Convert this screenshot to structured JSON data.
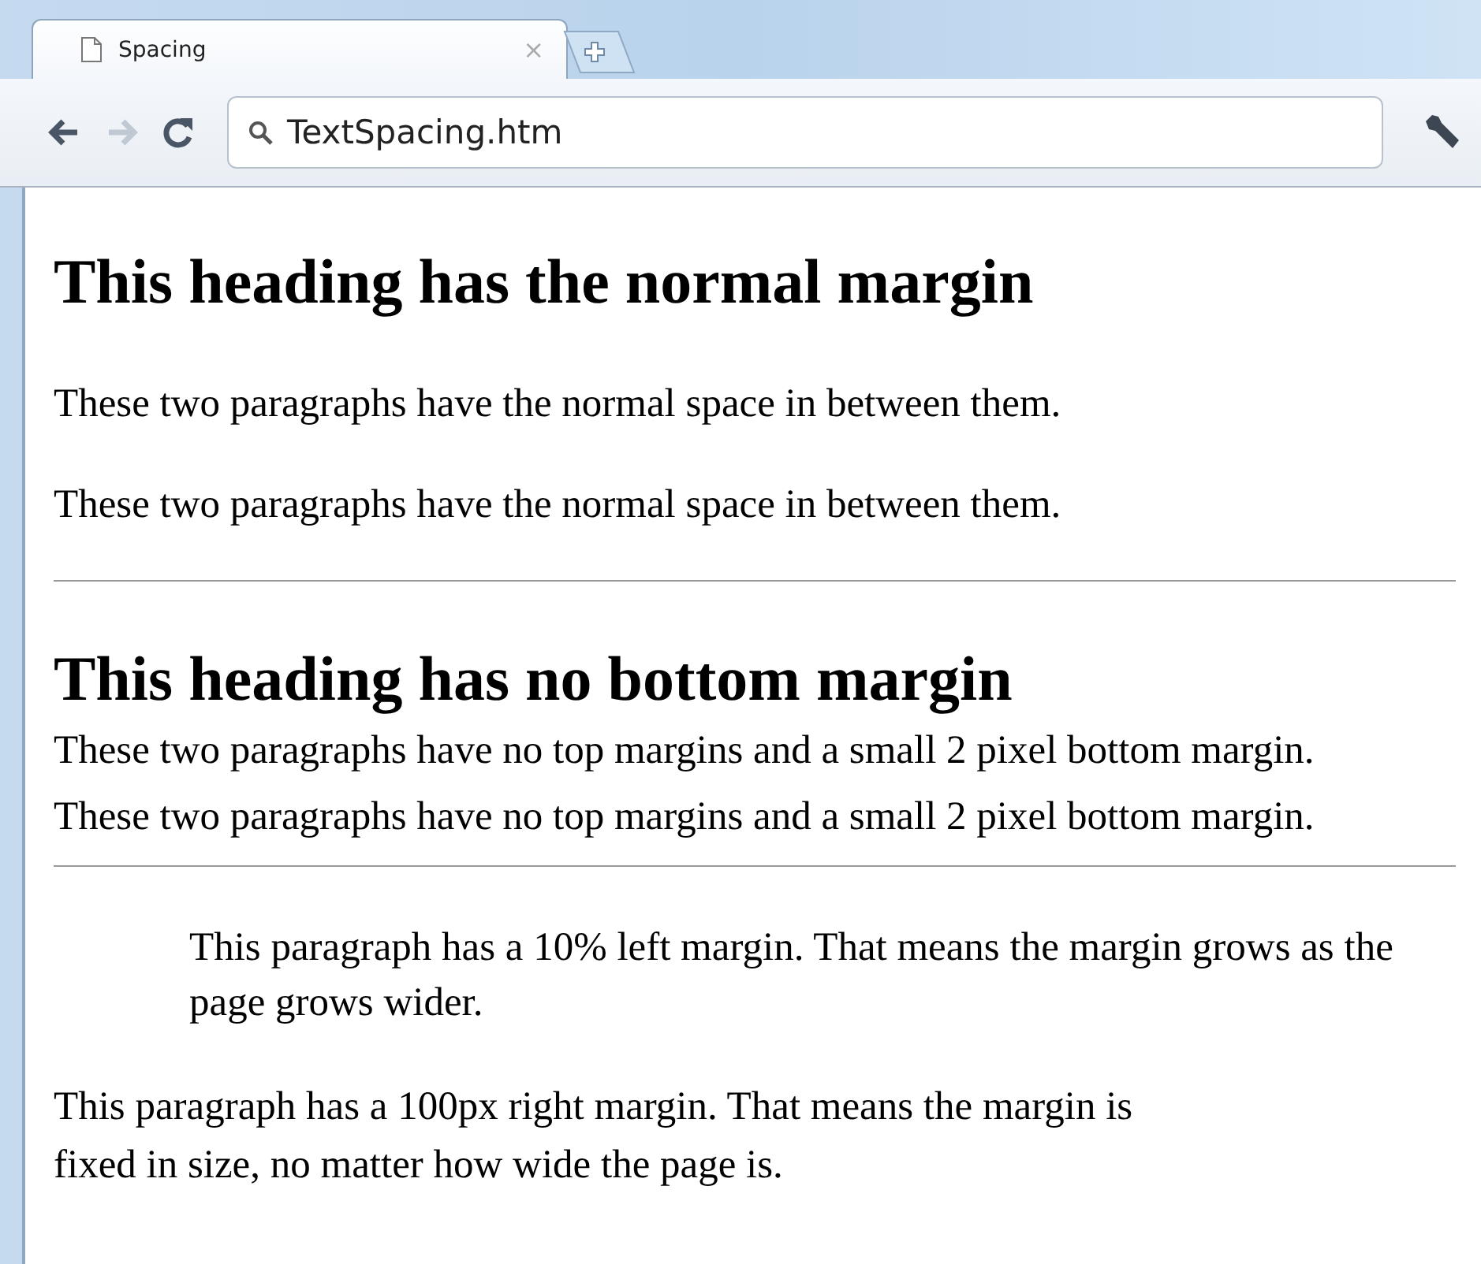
{
  "tabs": [
    {
      "title": "Spacing",
      "close": "×",
      "selected": true
    }
  ],
  "nav_buttons": [
    {
      "kind": "back",
      "disabled": false
    },
    {
      "kind": "forward",
      "disabled": true
    },
    {
      "kind": "reload",
      "disabled": false
    }
  ],
  "address_bar": {
    "value": "TextSpacing.htm"
  },
  "content": [
    {
      "kind": "heading",
      "text": "This heading has the normal margin"
    },
    {
      "kind": "paragraph",
      "text": "These two paragraphs have the normal space in between them."
    },
    {
      "kind": "paragraph",
      "text": "These two paragraphs have the normal space in between them."
    },
    {
      "kind": "rule"
    },
    {
      "kind": "heading",
      "text": "This heading has no bottom margin"
    },
    {
      "kind": "paragraph",
      "text": "These two paragraphs have no top margins and a small 2 pixel bottom margin."
    },
    {
      "kind": "paragraph",
      "text": "These two paragraphs have no top margins and a small 2 pixel bottom margin."
    },
    {
      "kind": "rule"
    },
    {
      "kind": "paragraph",
      "text": "This paragraph has a 10% left margin. That means the margin grows as the page grows wider."
    },
    {
      "kind": "paragraph",
      "text": "This paragraph has a 100px right margin. That means the margin is fixed in size, no matter how wide the page is."
    }
  ]
}
